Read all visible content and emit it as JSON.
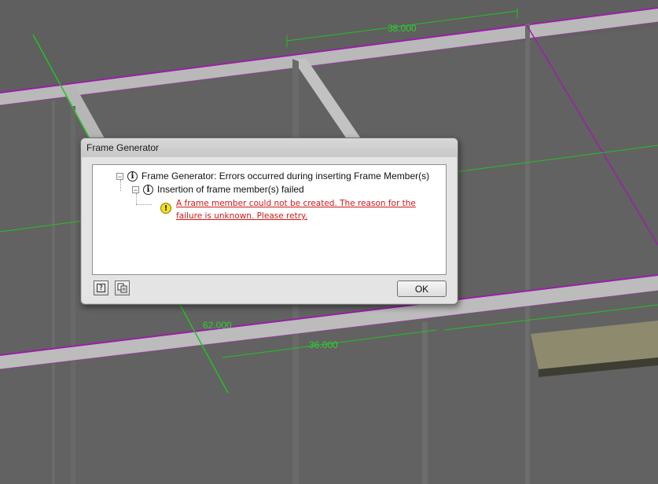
{
  "viewport": {
    "dimensions": {
      "top": "38.000",
      "middle": "36.000",
      "left": "62.000"
    }
  },
  "dialog": {
    "title": "Frame Generator",
    "tree": {
      "root": {
        "expander": "−",
        "label": "Frame Generator: Errors occurred during inserting Frame Member(s)"
      },
      "child": {
        "expander": "−",
        "label": "Insertion of frame member(s) failed"
      },
      "error": {
        "message": "A frame member could not be created.  The reason for the failure is unknown.  Please retry."
      }
    },
    "buttons": {
      "ok": "OK"
    }
  },
  "colors": {
    "dimension": "#2fd12f",
    "frame_edge": "#9b1fa8",
    "error_text": "#d01818",
    "warning": "#f2e11c"
  },
  "icons": [
    "info-icon",
    "warning-icon",
    "help-icon",
    "copy-icon"
  ]
}
